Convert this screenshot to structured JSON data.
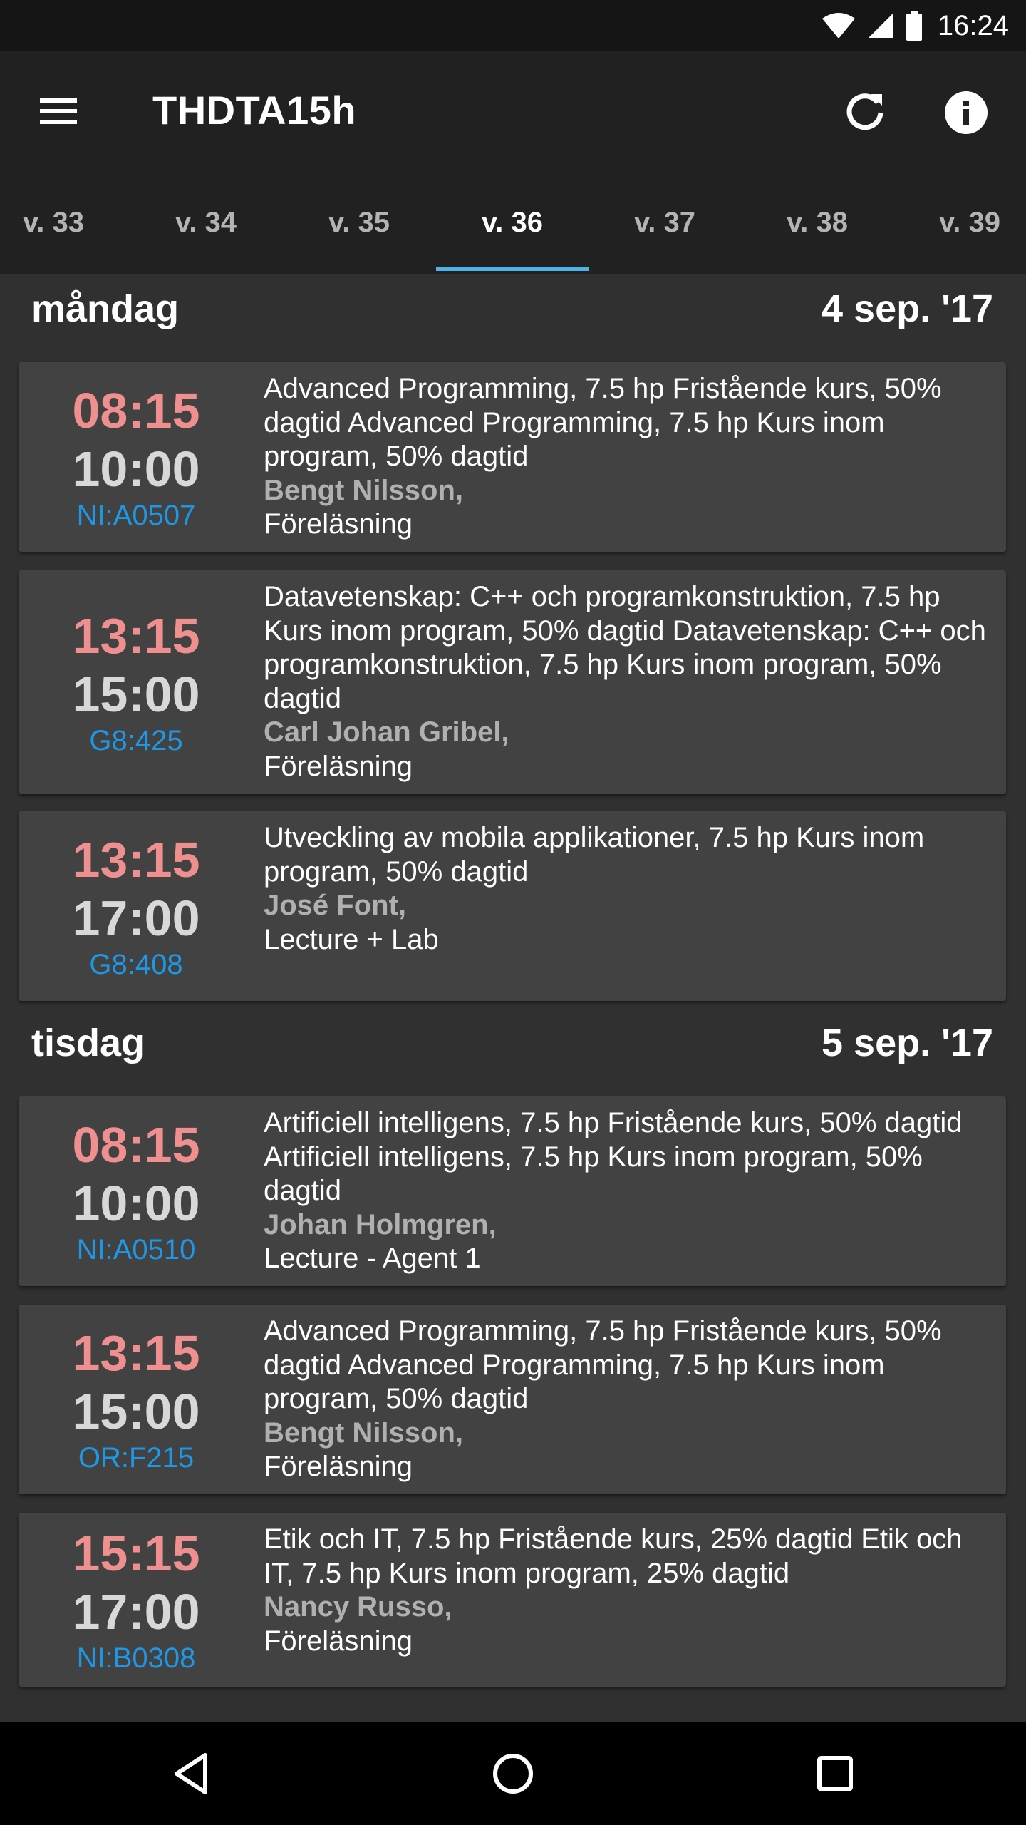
{
  "status_bar": {
    "time": "16:24",
    "icons": [
      "wifi-icon",
      "cell-signal-icon",
      "battery-icon"
    ]
  },
  "app_bar": {
    "title": "THDTA15h",
    "icons": [
      "menu-icon",
      "refresh-icon",
      "info-icon"
    ]
  },
  "tabs": [
    {
      "label": "v. 33"
    },
    {
      "label": "v. 34"
    },
    {
      "label": "v. 35"
    },
    {
      "label": "v. 36",
      "active": true
    },
    {
      "label": "v. 37"
    },
    {
      "label": "v. 38"
    },
    {
      "label": "v. 39"
    }
  ],
  "days": [
    {
      "name": "måndag",
      "date": "4 sep. '17",
      "events": [
        {
          "start": "08:15",
          "end": "10:00",
          "room": "NI:A0507",
          "course": "Advanced Programming, 7.5 hp Fristående kurs,  50% dagtid Advanced Programming, 7.5 hp Kurs inom program,  50% dagtid",
          "teacher": "Bengt Nilsson,",
          "kind": "Föreläsning"
        },
        {
          "start": "13:15",
          "end": "15:00",
          "room": "G8:425",
          "course": "Datavetenskap: C++ och programkonstruktion, 7.5 hp Kurs inom program,  50% dagtid Datavetenskap: C++ och programkonstruktion, 7.5 hp Kurs inom program,  50% dagtid",
          "teacher": "Carl Johan Gribel,",
          "kind": "Föreläsning"
        },
        {
          "start": "13:15",
          "end": "17:00",
          "room": "G8:408",
          "course": "Utveckling av mobila applikationer, 7.5 hp Kurs inom program,  50% dagtid",
          "teacher": "José Font,",
          "kind": "Lecture + Lab"
        }
      ]
    },
    {
      "name": "tisdag",
      "date": "5 sep. '17",
      "events": [
        {
          "start": "08:15",
          "end": "10:00",
          "room": "NI:A0510",
          "course": "Artificiell intelligens, 7.5 hp Fristående kurs,  50% dagtid Artificiell intelligens, 7.5 hp Kurs inom program,  50% dagtid",
          "teacher": "Johan Holmgren,",
          "kind": "Lecture - Agent 1"
        },
        {
          "start": "13:15",
          "end": "15:00",
          "room": "OR:F215",
          "course": "Advanced Programming, 7.5 hp Fristående kurs,  50% dagtid Advanced Programming, 7.5 hp Kurs inom program,  50% dagtid",
          "teacher": "Bengt Nilsson,",
          "kind": "Föreläsning"
        },
        {
          "start": "15:15",
          "end": "17:00",
          "room": "NI:B0308",
          "course": "Etik och IT, 7.5 hp Fristående kurs,  25% dagtid Etik och IT, 7.5 hp Kurs inom program,  25% dagtid",
          "teacher": "Nancy Russo,",
          "kind": "Föreläsning"
        }
      ]
    }
  ],
  "nav_bar": {
    "icons": [
      "back-icon",
      "home-icon",
      "recents-icon"
    ]
  },
  "colors": {
    "start_time": "#ef8f8f",
    "end_time": "#d8d8d8",
    "room": "#1e98e6",
    "tab_indicator": "#4fb3e8",
    "card_bg": "#424242",
    "page_bg": "#303030",
    "appbar_bg": "#212121"
  }
}
